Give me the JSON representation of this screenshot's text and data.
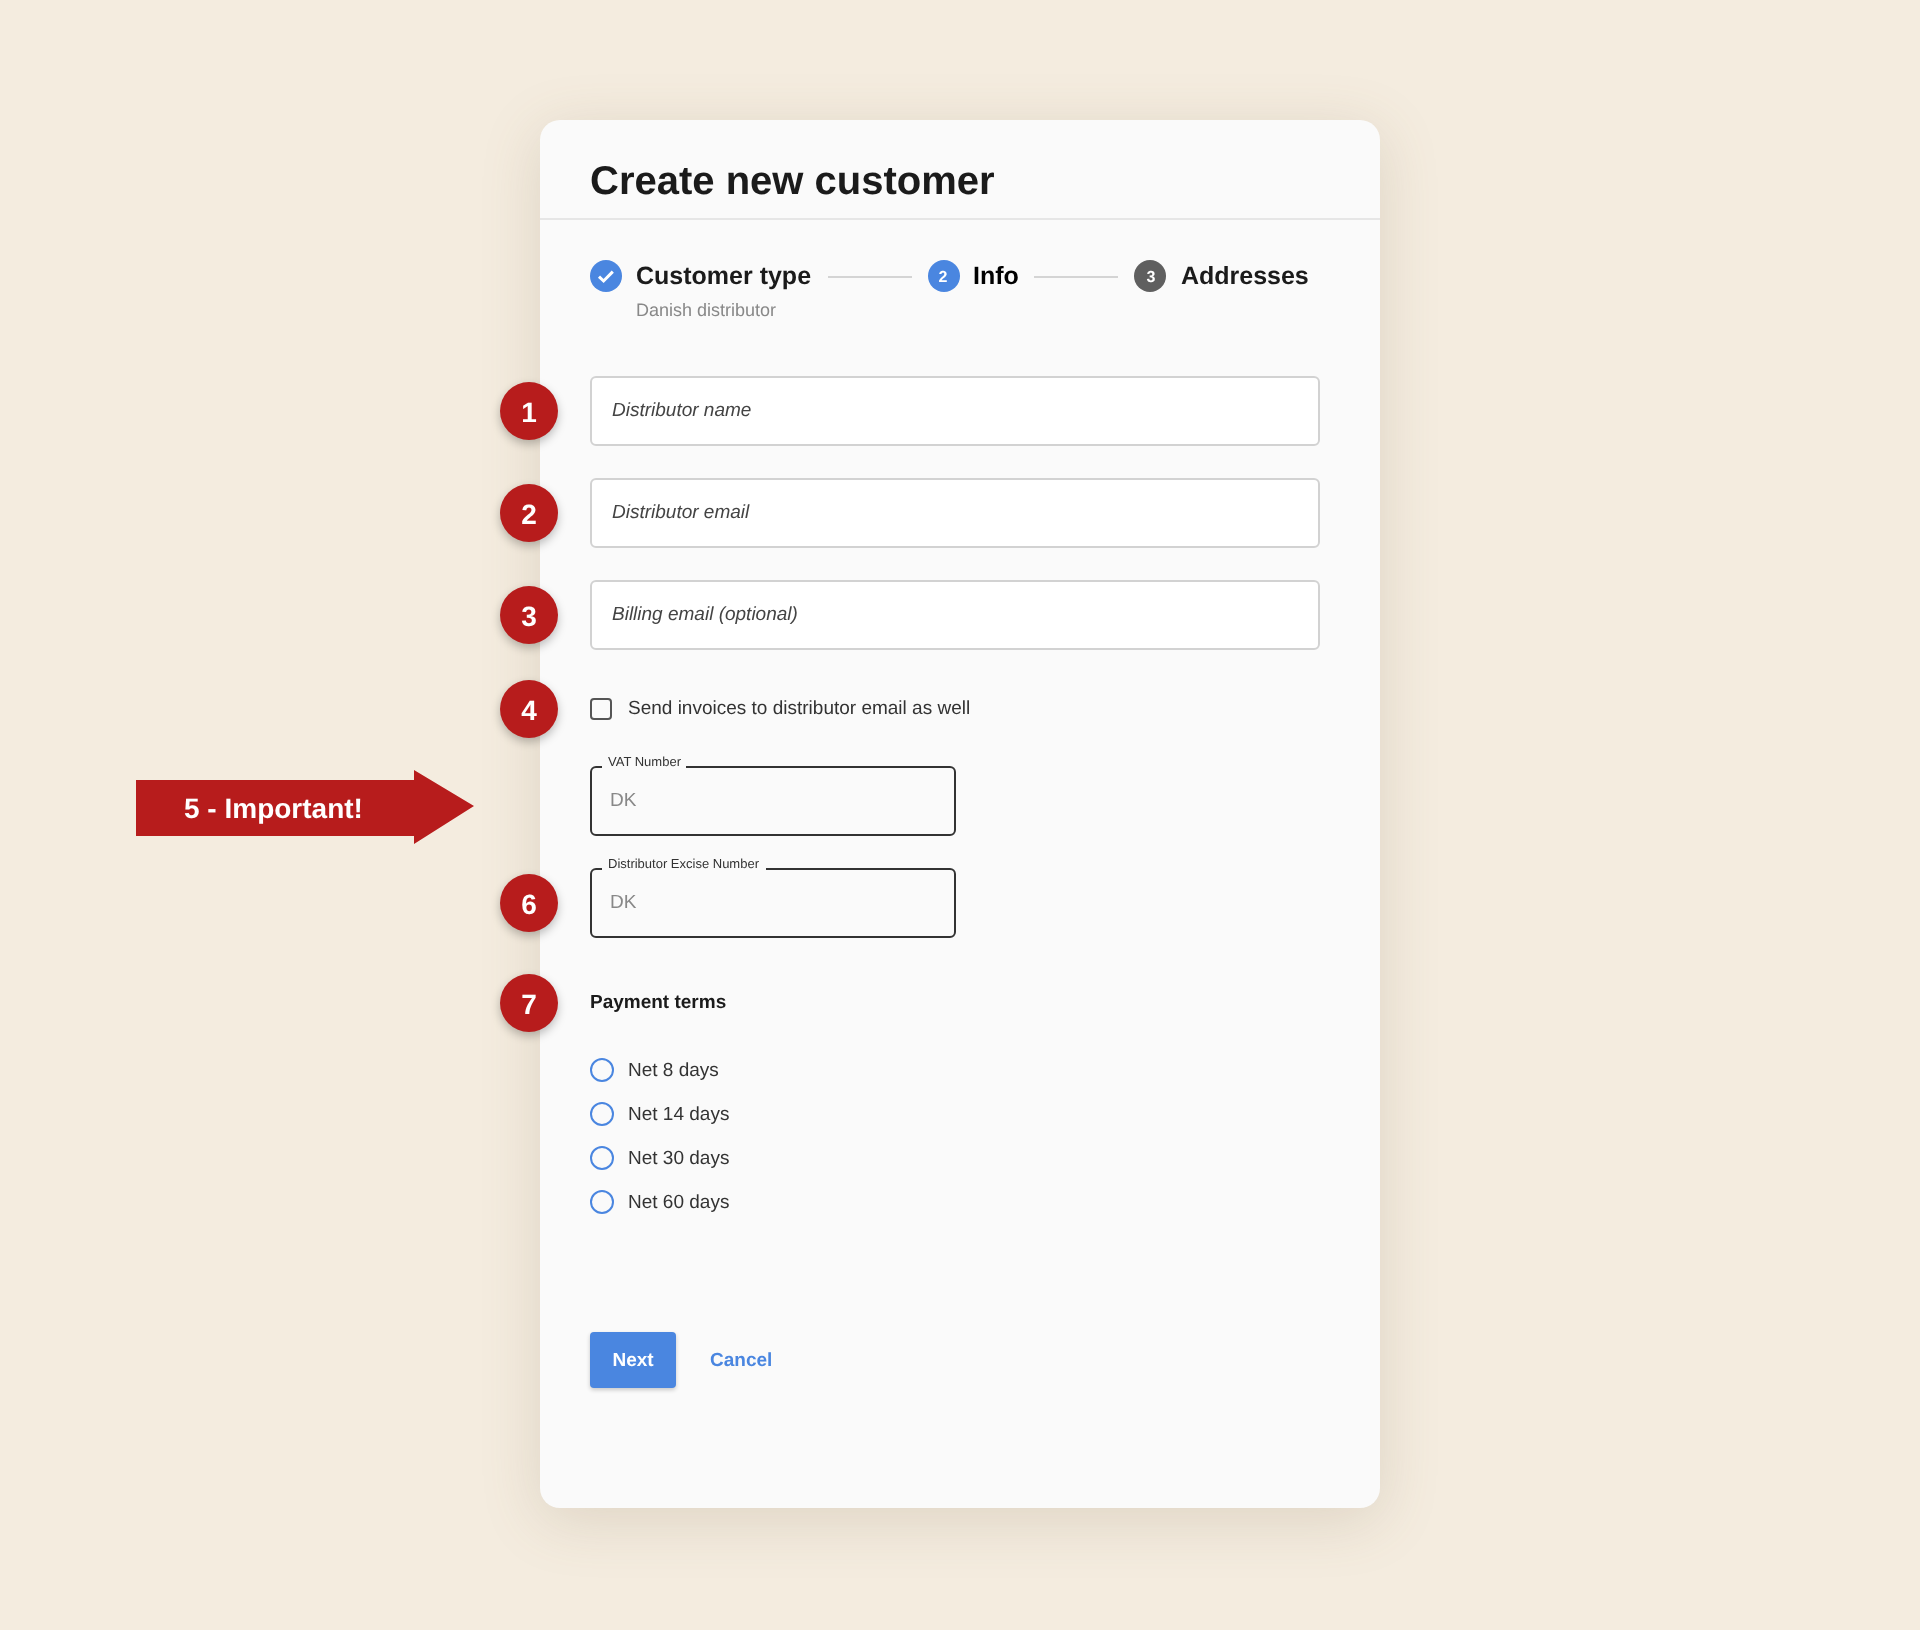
{
  "dialog": {
    "title": "Create new customer"
  },
  "steps": [
    {
      "label": "Customer type",
      "sub": "Danish distributor",
      "completed": true,
      "selected": false
    },
    {
      "label": "Info",
      "completed": false,
      "selected": true,
      "number": "2"
    },
    {
      "label": "Addresses",
      "completed": false,
      "selected": false,
      "number": "3"
    }
  ],
  "fields": [
    {
      "kind": "text",
      "placeholder": "Distributor name",
      "marker": {
        "kind": "circle",
        "text": "1"
      }
    },
    {
      "kind": "text",
      "placeholder": "Distributor email",
      "marker": {
        "kind": "circle",
        "text": "2"
      }
    },
    {
      "kind": "text",
      "placeholder": "Billing email (optional)",
      "marker": {
        "kind": "circle",
        "text": "3"
      }
    },
    {
      "kind": "checkbox",
      "label": "Send invoices to distributor email as well",
      "checked": false,
      "marker": {
        "kind": "circle",
        "text": "4"
      }
    },
    {
      "kind": "outlined",
      "label": "VAT Number",
      "placeholder": "DK",
      "marker": {
        "kind": "arrow",
        "text": "5 - Important!"
      }
    },
    {
      "kind": "outlined",
      "label": "Distributor Excise Number",
      "placeholder": "DK",
      "marker": {
        "kind": "circle",
        "text": "6"
      }
    }
  ],
  "payment_terms": {
    "label": "Payment terms",
    "marker": {
      "kind": "circle",
      "text": "7"
    },
    "options": [
      {
        "label": "Net 8 days",
        "selected": false
      },
      {
        "label": "Net 14 days",
        "selected": false
      },
      {
        "label": "Net 30 days",
        "selected": false
      },
      {
        "label": "Net 60 days",
        "selected": false
      }
    ]
  },
  "buttons": {
    "primary": "Next",
    "secondary": "Cancel"
  }
}
